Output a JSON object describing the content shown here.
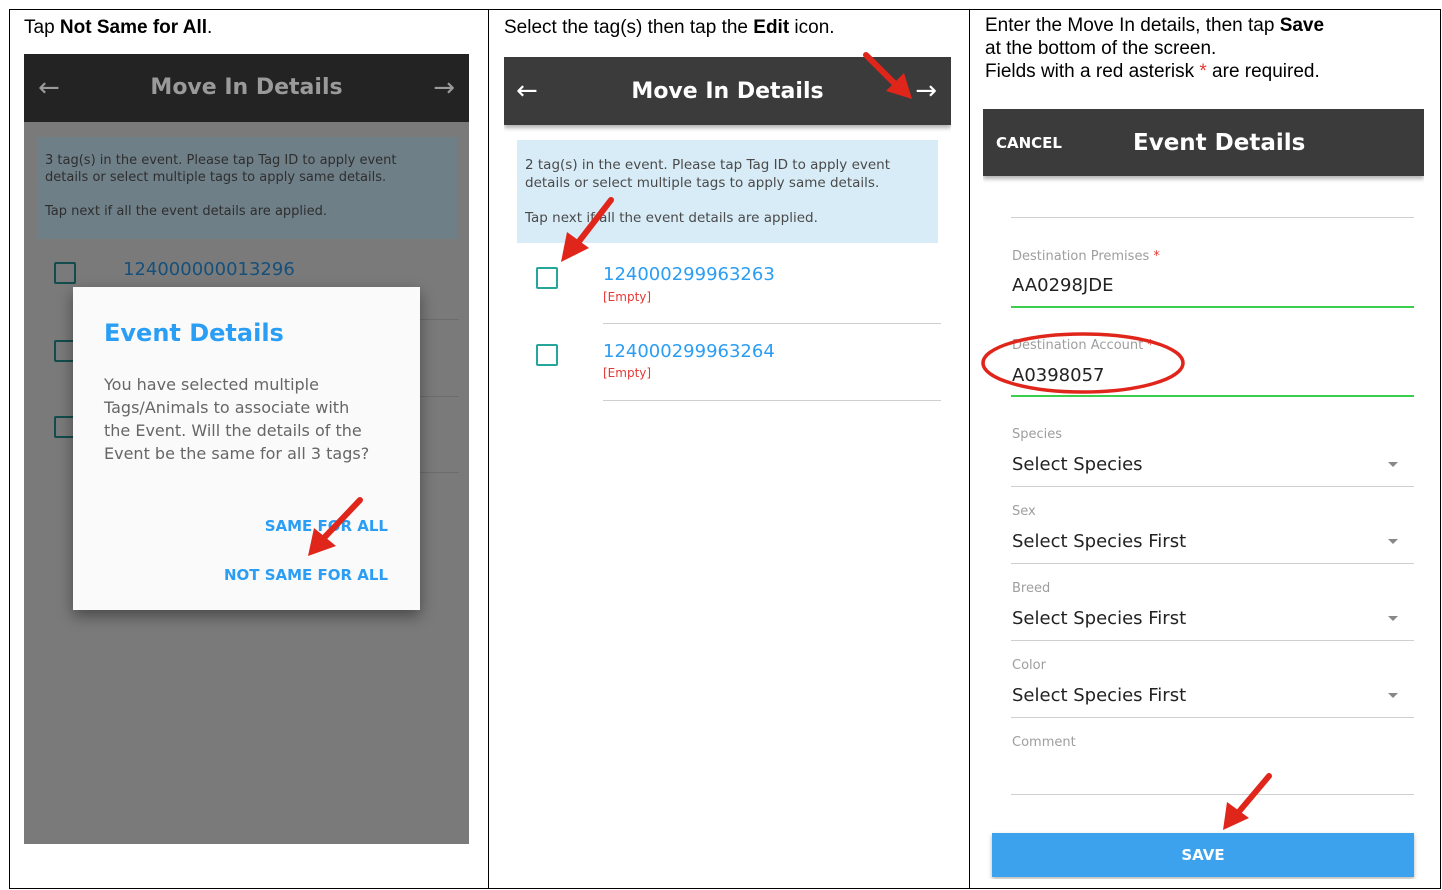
{
  "panels": [
    {
      "instruction": {
        "pre": "Tap ",
        "bold": "Not Same for All",
        "post": "."
      },
      "phone": {
        "header_title": "Move In Details",
        "info_line1": "3 tag(s) in the event. Please tap Tag ID to apply event",
        "info_line2": "details or select multiple tags to apply same details.",
        "info_line3": "Tap next if all the event details are applied.",
        "tag_partial": "124000000013296",
        "dialog": {
          "title": "Event Details",
          "body1": "You have selected multiple",
          "body2": "Tags/Animals to associate with",
          "body3": "the Event. Will the details of the",
          "body4": "Event be the same for all 3 tags?",
          "btn_same": "SAME FOR ALL",
          "btn_not_same": "NOT SAME FOR ALL"
        }
      }
    },
    {
      "instruction": {
        "pre": "Select the tag(s) then tap the ",
        "bold": "Edit",
        "post": " icon."
      },
      "phone": {
        "header_title": "Move In Details",
        "info_line1": "2 tag(s) in the event. Please tap Tag ID to apply event",
        "info_line2": "details or select multiple tags to apply same details.",
        "info_line3": "Tap next if all the event details are applied.",
        "tags": [
          {
            "id": "124000299963263",
            "status": "[Empty]"
          },
          {
            "id": "124000299963264",
            "status": "[Empty]"
          }
        ]
      }
    },
    {
      "instruction": {
        "line1_pre": "Enter the Move In details, then tap ",
        "line1_bold": "Save",
        "line2": "at the bottom of the screen.",
        "line3_pre": "Fields with a red asterisk ",
        "line3_star": "*",
        "line3_post": " are required."
      },
      "phone": {
        "cancel": "CANCEL",
        "header_title": "Event Details",
        "fields": [
          {
            "label": "Destination Premises",
            "star": "*",
            "value": "AA0298JDE"
          },
          {
            "label": "Destination Account",
            "star": "*",
            "value": "A0398057"
          },
          {
            "label": "Species",
            "value": "Select Species"
          },
          {
            "label": "Sex",
            "value": "Select Species First"
          },
          {
            "label": "Breed",
            "value": "Select Species First"
          },
          {
            "label": "Color",
            "value": "Select Species First"
          },
          {
            "label": "Comment",
            "value": ""
          }
        ],
        "save": "SAVE"
      }
    }
  ],
  "colors": {
    "toolbar": "#3b3b3b",
    "link_blue": "#2a9df4",
    "info_bg": "#d8ecf7",
    "save_bg": "#3da2ee",
    "arrow_red": "#e0261b",
    "valid_green": "#3ccf4e"
  },
  "icons": [
    "back-arrow-icon",
    "forward-arrow-icon",
    "checkbox-icon",
    "dropdown-caret-icon",
    "red-pointer-arrow-icon",
    "red-ellipse-highlight"
  ]
}
